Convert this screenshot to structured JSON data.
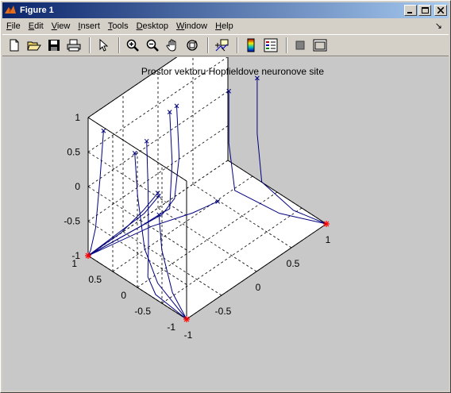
{
  "window": {
    "title": "Figure 1"
  },
  "menu": [
    {
      "key": "F",
      "rest": "ile"
    },
    {
      "key": "E",
      "rest": "dit"
    },
    {
      "key": "V",
      "rest": "iew"
    },
    {
      "key": "I",
      "rest": "nsert"
    },
    {
      "key": "T",
      "rest": "ools"
    },
    {
      "key": "D",
      "rest": "esktop"
    },
    {
      "key": "W",
      "rest": "indow"
    },
    {
      "key": "H",
      "rest": "elp"
    }
  ],
  "toolbar_icons": [
    "new-file-icon",
    "open-file-icon",
    "save-icon",
    "print-icon",
    "pointer-icon",
    "zoom-in-icon",
    "zoom-out-icon",
    "pan-hand-icon",
    "rotate-3d-icon",
    "data-cursor-icon",
    "colorbar-icon",
    "legend-icon",
    "hide-plot-tools-icon",
    "show-plot-tools-icon"
  ],
  "chart_data": {
    "type": "line",
    "title": "Prostor vektoru Hopfieldove neuronove site",
    "xlim": [
      -1,
      1
    ],
    "ylim": [
      -1,
      1
    ],
    "zlim": [
      -1,
      1
    ],
    "x_ticks": [
      "-1",
      "-0.5",
      "0",
      "0.5",
      "1"
    ],
    "y_ticks": [
      "1",
      "0.5",
      "0",
      "-0.5",
      "-1"
    ],
    "z_ticks": [
      "1",
      "0.5",
      "0",
      "-0.5",
      "-1"
    ],
    "grid": true,
    "line_color": "#00007f",
    "start_marker_color": "#00007f",
    "attractor_color": "#ff0000",
    "attractors": [
      [
        1,
        -1,
        -1
      ],
      [
        -1,
        1,
        -1
      ],
      [
        -1,
        -1,
        -1
      ]
    ]
  }
}
